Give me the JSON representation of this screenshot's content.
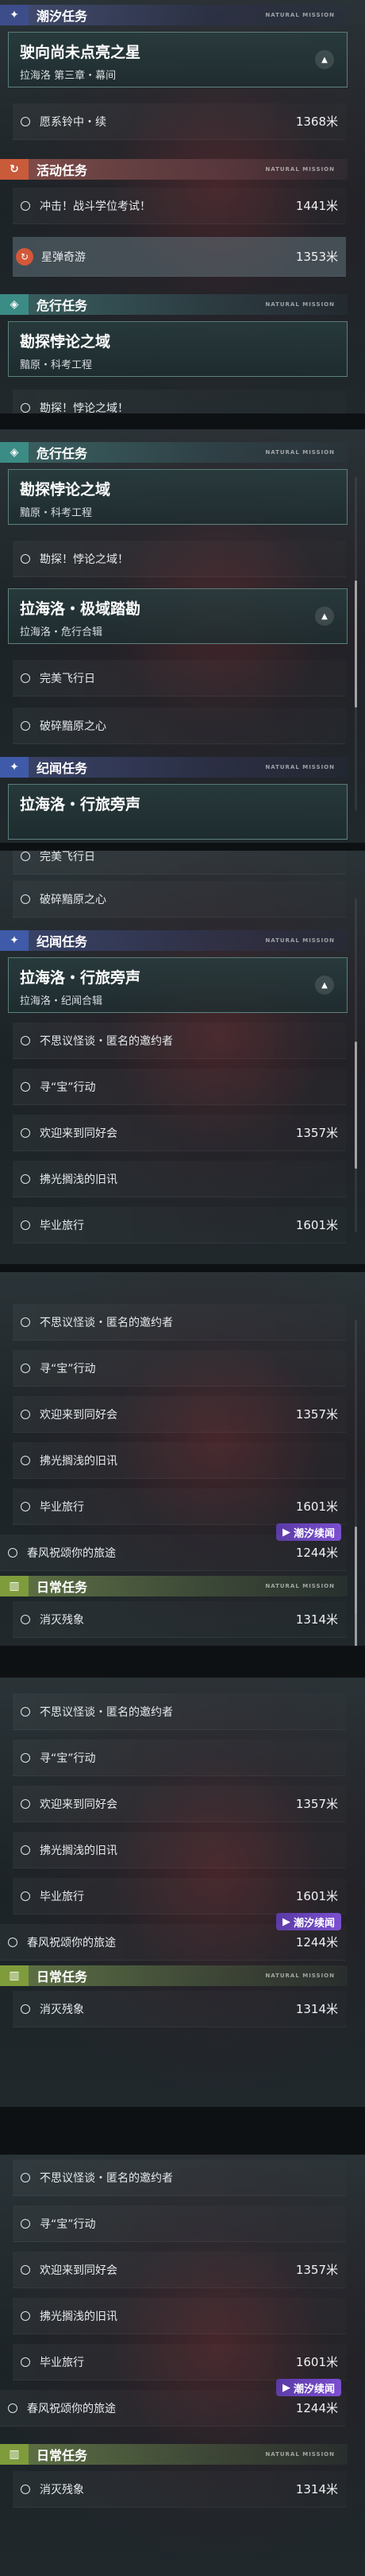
{
  "tide_label": "潮汐任务",
  "event_label": "活动任务",
  "danger_label": "危行任务",
  "chron_label": "纪闻任务",
  "daily_label": "日常任务",
  "deco_text": "NATURAL MISSION",
  "tide_head": {
    "title": "驶向尚未点亮之星",
    "sub": "拉海洛 第三章・幕间"
  },
  "tide_rows": [
    {
      "label": "愿系铃中・续",
      "dist": "1368米"
    }
  ],
  "event_rows": [
    {
      "label": "冲击！战斗学位考试！",
      "dist": "1441米"
    },
    {
      "label": "星弹奇游",
      "dist": "1353米"
    }
  ],
  "danger_head": {
    "title": "勘探悖论之域",
    "sub": "黯原・科考工程"
  },
  "danger_rows_cut": [
    {
      "label": "勘探！悖论之域！"
    }
  ],
  "danger_head2": {
    "title": "拉海洛・极域踏勘",
    "sub": "拉海洛・危行合辑"
  },
  "danger_rows2": [
    {
      "label": "完美飞行日"
    },
    {
      "label": "破碎黯原之心"
    }
  ],
  "chron_head": {
    "title": "拉海洛・行旅旁声",
    "sub": "拉海洛・纪闻合辑"
  },
  "chron_rows": [
    {
      "label": "不思议怪谈・匿名的邀约者",
      "dist": ""
    },
    {
      "label": "寻“宝”行动",
      "dist": ""
    },
    {
      "label": "欢迎来到同好会",
      "dist": "1357米"
    },
    {
      "label": "拂光搁浅的旧讯",
      "dist": ""
    },
    {
      "label": "毕业旅行",
      "dist": "1601米"
    }
  ],
  "spring_row": {
    "label": "春风祝颂你的旅途",
    "dist": "1244米"
  },
  "tide_continue": "潮汐续闻",
  "daily_rows": [
    {
      "label": "消灭残象",
      "dist": "1314米"
    }
  ]
}
